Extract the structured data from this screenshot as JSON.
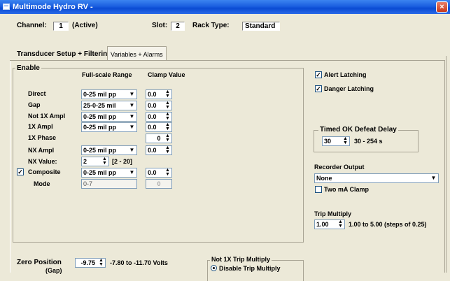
{
  "window": {
    "title": "Multimode Hydro RV -",
    "close_label": "×"
  },
  "header": {
    "channel_label": "Channel:",
    "channel_value": "1",
    "channel_status": "(Active)",
    "slot_label": "Slot:",
    "slot_value": "2",
    "rack_type_label": "Rack Type:",
    "rack_type_value": "Standard"
  },
  "tabs": [
    {
      "label": "Transducer Setup + Filtering",
      "active": true
    },
    {
      "label": "Variables + Alarms",
      "active": false
    }
  ],
  "enable_section": {
    "title": "Enable",
    "col_fullscale": "Full-scale Range",
    "col_clamp": "Clamp Value",
    "rows": [
      {
        "label": "Direct",
        "range": "0-25 mil pp",
        "clamp": "0.0"
      },
      {
        "label": "Gap",
        "range": "25-0-25 mil",
        "clamp": "0.0"
      },
      {
        "label": "Not 1X Ampl",
        "range": "0-25 mil pp",
        "clamp": "0.0"
      },
      {
        "label": "1X Ampl",
        "range": "0-25 mil pp",
        "clamp": "0.0"
      },
      {
        "label": "1X Phase",
        "range": "",
        "clamp": "0"
      },
      {
        "label": "NX Ampl",
        "range": "0-25 mil pp",
        "clamp": "0.0"
      }
    ],
    "nx_value_label": "NX Value:",
    "nx_value": "2",
    "nx_range": "[2 - 20]",
    "composite_label": "Composite",
    "composite_checked": "✓",
    "composite_range": "0-25 mil pp",
    "composite_clamp": "0.0",
    "mode_label": "Mode",
    "mode_value": "0-7",
    "mode_clamp": "0"
  },
  "alerts": {
    "alert_latching_label": "Alert Latching",
    "alert_latching_checked": "✓",
    "danger_latching_label": "Danger Latching",
    "danger_latching_checked": "✓"
  },
  "timed_ok": {
    "title": "Timed OK Defeat Delay",
    "value": "30",
    "range": "30 - 254 s"
  },
  "recorder": {
    "title": "Recorder Output",
    "value": "None",
    "two_ma_clamp_label": "Two mA Clamp"
  },
  "trip_multiply": {
    "title": "Trip Multiply",
    "value": "1.00",
    "range": "1.00 to 5.00 (steps of 0.25)"
  },
  "zero_position": {
    "label": "Zero Position",
    "sublabel": "(Gap)",
    "value": "-9.75",
    "range": "-7.80 to -11.70 Volts"
  },
  "not1x_trip": {
    "title": "Not 1X Trip Multiply",
    "option": "Disable Trip Multiply"
  },
  "colors": {
    "titlebar": "#0a4bd3",
    "window_bg": "#ece9d8",
    "close_button": "#c8391b"
  }
}
